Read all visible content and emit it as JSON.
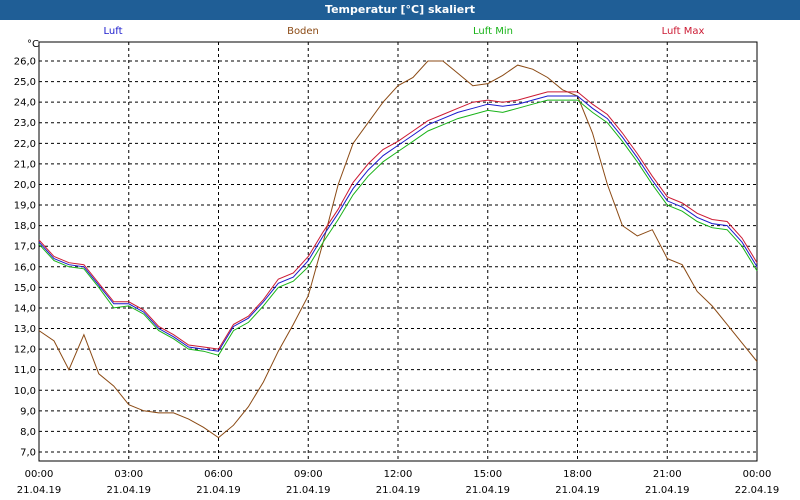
{
  "window": {
    "title": "Temperatur [°C] skaliert"
  },
  "chart_data": {
    "type": "line",
    "title": "Temperatur [°C] skaliert",
    "ylabel": "°C",
    "xlabel": "",
    "ylim": [
      7.0,
      26.0
    ],
    "y_ticks": [
      "7,0",
      "8,0",
      "9,0",
      "10,0",
      "11,0",
      "12,0",
      "13,0",
      "14,0",
      "15,0",
      "16,0",
      "17,0",
      "18,0",
      "19,0",
      "20,0",
      "21,0",
      "22,0",
      "23,0",
      "24,0",
      "25,0",
      "26,0"
    ],
    "x_ticks": [
      {
        "time": "00:00",
        "date": "21.04.19"
      },
      {
        "time": "03:00",
        "date": "21.04.19"
      },
      {
        "time": "06:00",
        "date": "21.04.19"
      },
      {
        "time": "09:00",
        "date": "21.04.19"
      },
      {
        "time": "12:00",
        "date": "21.04.19"
      },
      {
        "time": "15:00",
        "date": "21.04.19"
      },
      {
        "time": "18:00",
        "date": "21.04.19"
      },
      {
        "time": "21:00",
        "date": "21.04.19"
      },
      {
        "time": "00:00",
        "date": "22.04.19"
      }
    ],
    "grid": true,
    "legend_position": "top",
    "series": [
      {
        "name": "Luft",
        "color": "#1a1acc",
        "x": [
          0,
          0.5,
          1,
          1.5,
          2,
          2.5,
          3,
          3.5,
          4,
          4.5,
          5,
          5.5,
          6,
          6.5,
          7,
          7.5,
          8,
          8.5,
          9,
          9.5,
          10,
          10.5,
          11,
          11.5,
          12,
          12.5,
          13,
          13.5,
          14,
          14.5,
          15,
          15.5,
          16,
          16.5,
          17,
          17.5,
          18,
          18.5,
          19,
          19.5,
          20,
          20.5,
          21,
          21.5,
          22,
          22.5,
          23,
          23.5,
          24
        ],
        "y": [
          17.2,
          16.4,
          16.1,
          16.0,
          15.1,
          14.2,
          14.2,
          13.8,
          13.0,
          12.6,
          12.1,
          12.0,
          11.9,
          13.1,
          13.5,
          14.3,
          15.2,
          15.5,
          16.3,
          17.5,
          18.6,
          19.8,
          20.7,
          21.4,
          21.9,
          22.4,
          22.9,
          23.2,
          23.5,
          23.7,
          23.9,
          23.8,
          23.9,
          24.1,
          24.3,
          24.3,
          24.3,
          23.7,
          23.2,
          22.3,
          21.3,
          20.2,
          19.2,
          18.9,
          18.4,
          18.1,
          18.0,
          17.2,
          16.0
        ]
      },
      {
        "name": "Boden",
        "color": "#8b4a14",
        "x": [
          0,
          0.5,
          1,
          1.5,
          2,
          2.5,
          3,
          3.5,
          4,
          4.5,
          5,
          5.5,
          6,
          6.5,
          7,
          7.5,
          8,
          8.5,
          9,
          9.5,
          10,
          10.5,
          11,
          11.5,
          12,
          12.5,
          13,
          13.5,
          14,
          14.5,
          15,
          15.5,
          16,
          16.5,
          17,
          17.5,
          18,
          18.5,
          19,
          19.5,
          20,
          20.5,
          21,
          21.5,
          22,
          22.5,
          23,
          23.5,
          24
        ],
        "y": [
          12.9,
          12.4,
          11.0,
          12.7,
          10.8,
          10.2,
          9.3,
          9.0,
          8.9,
          8.9,
          8.6,
          8.2,
          7.7,
          8.3,
          9.2,
          10.4,
          11.9,
          13.2,
          14.6,
          17.2,
          20.0,
          22.0,
          23.0,
          24.0,
          24.8,
          25.2,
          26.0,
          26.0,
          25.4,
          24.8,
          24.9,
          25.3,
          25.8,
          25.6,
          25.2,
          24.6,
          24.3,
          22.5,
          20.0,
          18.0,
          17.5,
          17.8,
          16.4,
          16.1,
          14.8,
          14.1,
          13.2,
          12.3,
          11.4
        ]
      },
      {
        "name": "Luft Min",
        "color": "#19b319",
        "x": [
          0,
          0.5,
          1,
          1.5,
          2,
          2.5,
          3,
          3.5,
          4,
          4.5,
          5,
          5.5,
          6,
          6.5,
          7,
          7.5,
          8,
          8.5,
          9,
          9.5,
          10,
          10.5,
          11,
          11.5,
          12,
          12.5,
          13,
          13.5,
          14,
          14.5,
          15,
          15.5,
          16,
          16.5,
          17,
          17.5,
          18,
          18.5,
          19,
          19.5,
          20,
          20.5,
          21,
          21.5,
          22,
          22.5,
          23,
          23.5,
          24
        ],
        "y": [
          17.1,
          16.3,
          16.0,
          15.9,
          15.0,
          14.0,
          14.1,
          13.7,
          12.9,
          12.5,
          12.0,
          11.9,
          11.7,
          12.9,
          13.3,
          14.1,
          15.0,
          15.3,
          16.0,
          17.2,
          18.3,
          19.5,
          20.4,
          21.1,
          21.6,
          22.1,
          22.6,
          22.9,
          23.2,
          23.4,
          23.6,
          23.5,
          23.7,
          23.9,
          24.1,
          24.1,
          24.1,
          23.5,
          23.0,
          22.1,
          21.1,
          20.0,
          19.0,
          18.7,
          18.2,
          17.9,
          17.8,
          17.0,
          15.8
        ]
      },
      {
        "name": "Luft Max",
        "color": "#cc1a33",
        "x": [
          0,
          0.5,
          1,
          1.5,
          2,
          2.5,
          3,
          3.5,
          4,
          4.5,
          5,
          5.5,
          6,
          6.5,
          7,
          7.5,
          8,
          8.5,
          9,
          9.5,
          10,
          10.5,
          11,
          11.5,
          12,
          12.5,
          13,
          13.5,
          14,
          14.5,
          15,
          15.5,
          16,
          16.5,
          17,
          17.5,
          18,
          18.5,
          19,
          19.5,
          20,
          20.5,
          21,
          21.5,
          22,
          22.5,
          23,
          23.5,
          24
        ],
        "y": [
          17.3,
          16.5,
          16.2,
          16.1,
          15.2,
          14.3,
          14.3,
          13.9,
          13.1,
          12.7,
          12.2,
          12.1,
          12.0,
          13.2,
          13.6,
          14.4,
          15.4,
          15.7,
          16.5,
          17.7,
          18.8,
          20.1,
          21.0,
          21.7,
          22.1,
          22.6,
          23.1,
          23.4,
          23.7,
          24.0,
          24.1,
          24.0,
          24.1,
          24.3,
          24.5,
          24.5,
          24.5,
          23.9,
          23.4,
          22.5,
          21.5,
          20.4,
          19.4,
          19.1,
          18.6,
          18.3,
          18.2,
          17.4,
          16.2
        ]
      }
    ]
  }
}
